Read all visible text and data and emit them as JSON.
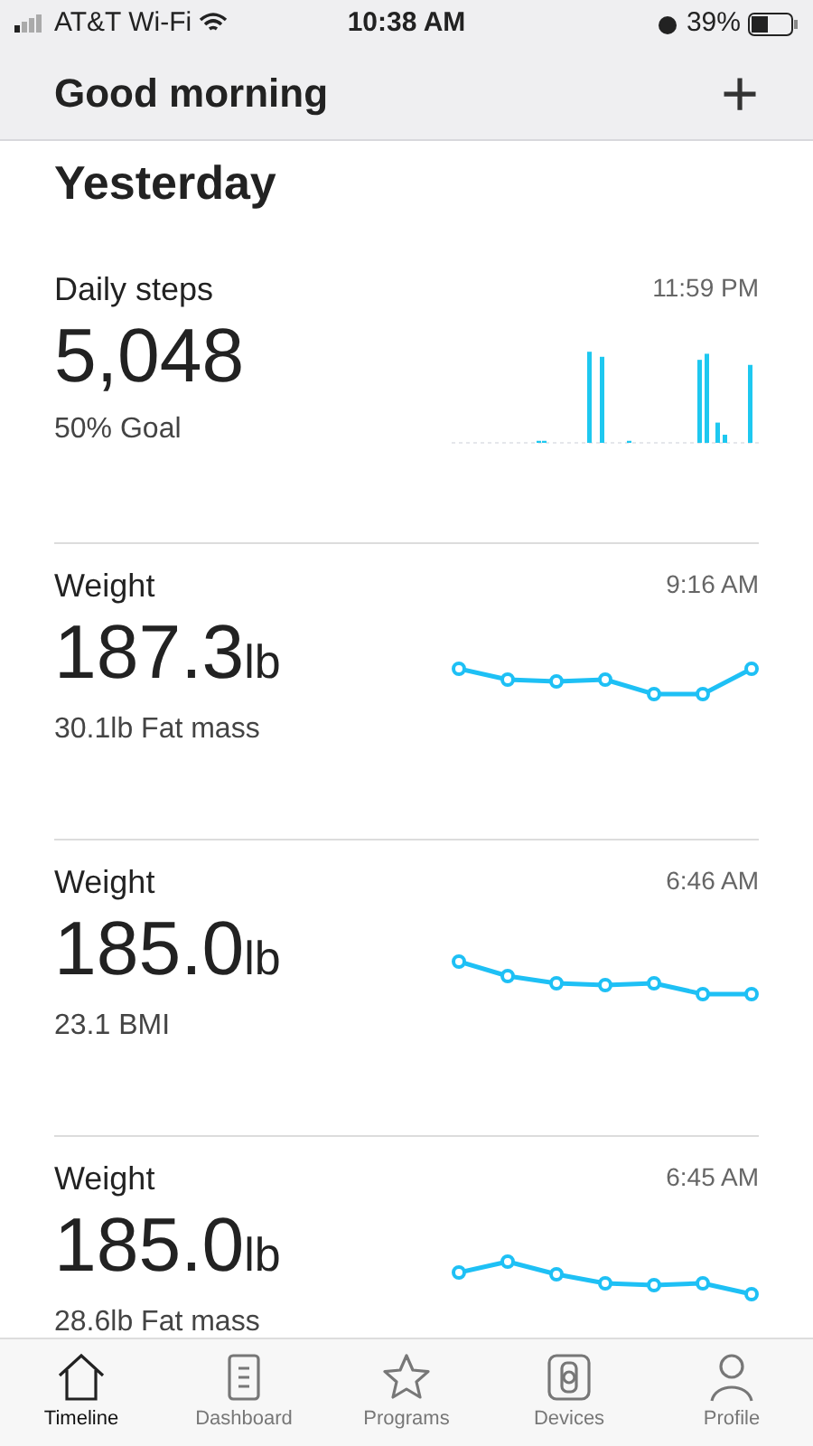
{
  "status_bar": {
    "carrier": "AT&T Wi-Fi",
    "time": "10:38 AM",
    "battery": "39%"
  },
  "header": {
    "title": "Good morning",
    "add": "+"
  },
  "section_title": "Yesterday",
  "cards": [
    {
      "kind": "bars",
      "title": "Daily steps",
      "time": "11:59 PM",
      "value": "5,048",
      "detail": "50% Goal"
    },
    {
      "kind": "line",
      "title": "Weight",
      "time": "9:16 AM",
      "value": "187.3",
      "unit": "lb",
      "detail": "30.1lb Fat mass"
    },
    {
      "kind": "line",
      "title": "Weight",
      "time": "6:46 AM",
      "value": "185.0",
      "unit": "lb",
      "detail": "23.1 BMI"
    },
    {
      "kind": "line",
      "title": "Weight",
      "time": "6:45 AM",
      "value": "185.0",
      "unit": "lb",
      "detail": "28.6lb Fat mass"
    }
  ],
  "tabs": [
    {
      "label": "Timeline",
      "selected": true
    },
    {
      "label": "Dashboard",
      "selected": false
    },
    {
      "label": "Programs",
      "selected": false
    },
    {
      "label": "Devices",
      "selected": false
    },
    {
      "label": "Profile",
      "selected": false
    }
  ]
}
